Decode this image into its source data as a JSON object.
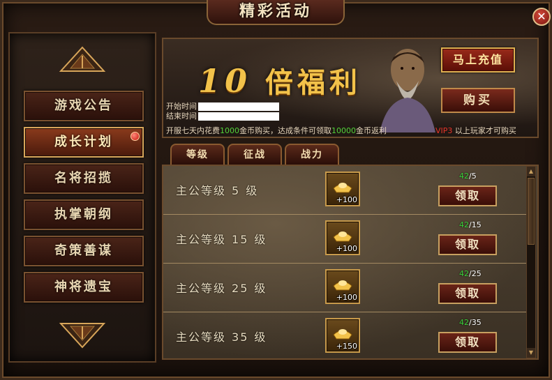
{
  "window": {
    "title": "精彩活动",
    "close_label": "✕"
  },
  "sidebar": {
    "items": [
      {
        "label": "游戏公告",
        "active": false
      },
      {
        "label": "成长计划",
        "active": true
      },
      {
        "label": "名将招揽",
        "active": false
      },
      {
        "label": "执掌朝纲",
        "active": false
      },
      {
        "label": "奇策善谋",
        "active": false
      },
      {
        "label": "神将遗宝",
        "active": false
      }
    ]
  },
  "banner": {
    "title_num": "10",
    "title_text": "倍福利",
    "start_label": "开始时间",
    "end_label": "结束时间",
    "note_part1": "开服七天内花费",
    "note_num1": "1000",
    "note_part2": "金币购买，达成条件可领取",
    "note_num2": "10000",
    "note_part3": "金币返利",
    "vip_label": "VIP3",
    "vip_rest": " 以上玩家才可购买",
    "recharge_label": "马上充值",
    "buy_label": "购买"
  },
  "tabs": [
    {
      "label": "等级"
    },
    {
      "label": "征战"
    },
    {
      "label": "战力"
    }
  ],
  "rows": [
    {
      "prefix": "主公等级",
      "level": "5",
      "suffix": "级",
      "reward_count": "+100",
      "progress_current": "42",
      "progress_target": "/5",
      "claim_label": "领取"
    },
    {
      "prefix": "主公等级",
      "level": "15",
      "suffix": "级",
      "reward_count": "+100",
      "progress_current": "42",
      "progress_target": "/15",
      "claim_label": "领取"
    },
    {
      "prefix": "主公等级",
      "level": "25",
      "suffix": "级",
      "reward_count": "+100",
      "progress_current": "42",
      "progress_target": "/25",
      "claim_label": "领取"
    },
    {
      "prefix": "主公等级",
      "level": "35",
      "suffix": "级",
      "reward_count": "+150",
      "progress_current": "42",
      "progress_target": "/35",
      "claim_label": "领取"
    }
  ],
  "colors": {
    "accent_gold": "#f2c24a",
    "progress_green": "#3ad23a",
    "vip_red": "#e8352a"
  }
}
